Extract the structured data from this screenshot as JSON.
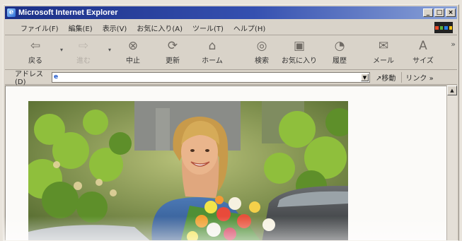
{
  "window": {
    "title": "Microsoft Internet Explorer",
    "controls": [
      "_",
      "□",
      "×"
    ]
  },
  "menu": [
    "ファイル(F)",
    "編集(E)",
    "表示(V)",
    "お気に入り(A)",
    "ツール(T)",
    "ヘルプ(H)"
  ],
  "toolbar": {
    "back": "戻る",
    "forward": "進む",
    "stop": "中止",
    "refresh": "更新",
    "home": "ホーム",
    "search": "検索",
    "favorites": "お気に入り",
    "history": "履歴",
    "mail": "メール",
    "size": "サイズ",
    "more": "»"
  },
  "address": {
    "label": "アドレス(D)",
    "value": "",
    "go": "移動",
    "links": "リンク »"
  },
  "icons": {
    "back": "arrow-left-icon",
    "forward": "arrow-right-icon",
    "stop": "stop-icon",
    "refresh": "refresh-icon",
    "home": "home-icon",
    "search": "search-icon",
    "favorites": "favorites-icon",
    "history": "history-icon",
    "mail": "mail-icon",
    "size": "font-size-icon"
  },
  "colors": {
    "titlebar_start": "#1b2f86",
    "titlebar_end": "#8aa2d8",
    "chrome": "#d9d3c9"
  }
}
